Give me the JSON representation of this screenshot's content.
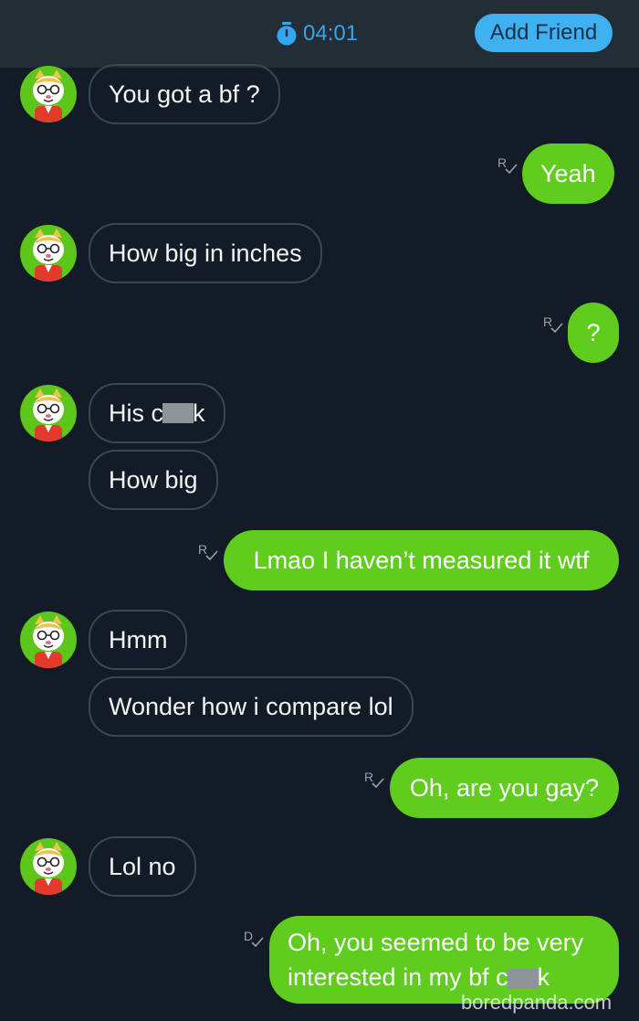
{
  "header": {
    "timer": "04:01",
    "add_friend_label": "Add Friend"
  },
  "messages": [
    {
      "from": "them",
      "text": "You got a bf ?"
    },
    {
      "from": "me",
      "text": "Yeah",
      "receipt": "R"
    },
    {
      "from": "them",
      "text": "How big in inches"
    },
    {
      "from": "me",
      "text": "?",
      "receipt": "R"
    },
    {
      "from": "them",
      "text_before": "His c",
      "text_after": "k",
      "censored": true
    },
    {
      "from": "them",
      "text": "How big"
    },
    {
      "from": "me",
      "text": "Lmao I haven’t measured it wtf",
      "receipt": "R"
    },
    {
      "from": "them",
      "text": "Hmm"
    },
    {
      "from": "them",
      "text": "Wonder how i compare lol"
    },
    {
      "from": "me",
      "text": "Oh, are you gay?",
      "receipt": "R"
    },
    {
      "from": "them",
      "text": "Lol no"
    },
    {
      "from": "me",
      "line1": "Oh, you seemed to be very",
      "line2_before": "interested in my bf c",
      "line2_after": "k",
      "censored": true,
      "receipt": "D"
    }
  ],
  "watermark": "boredpanda.com",
  "colors": {
    "background": "#131c26",
    "header": "#232d36",
    "accent_blue": "#3fb1f0",
    "outgoing_bubble": "#5fcc1e",
    "avatar_green": "#5cc71a"
  }
}
